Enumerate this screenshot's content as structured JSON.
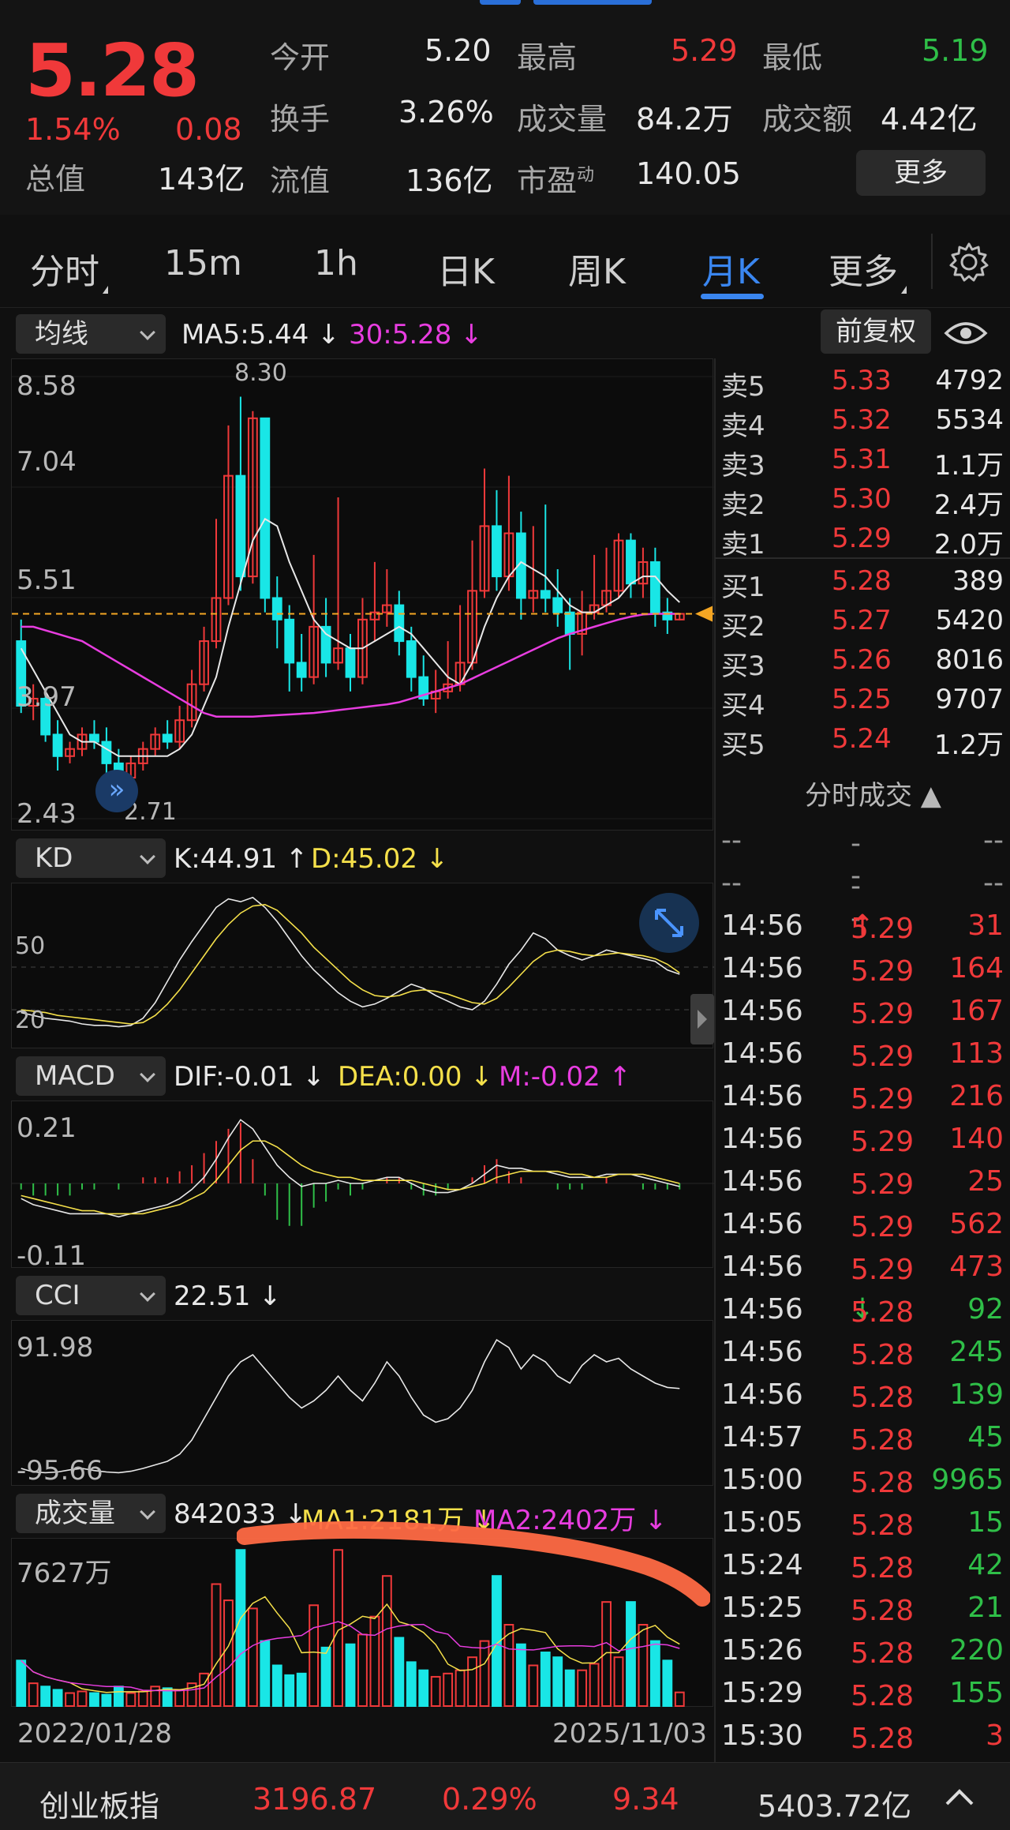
{
  "quote": {
    "price": "5.28",
    "change_pct": "1.54%",
    "change": "0.08",
    "open_label": "今开",
    "open": "5.20",
    "high_label": "最高",
    "high": "5.29",
    "low_label": "最低",
    "low": "5.19",
    "turnover_label": "换手",
    "turnover": "3.26%",
    "volume_label": "成交量",
    "volume": "84.2万",
    "amount_label": "成交额",
    "amount": "4.42亿",
    "mcap_label": "总值",
    "mcap": "143亿",
    "float_label": "流值",
    "float": "136亿",
    "pe_label": "市盈",
    "pe_sup": "动",
    "pe": "140.05",
    "more_label": "更多"
  },
  "tabs": [
    {
      "label": "分时"
    },
    {
      "label": "15m"
    },
    {
      "label": "1h"
    },
    {
      "label": "日K"
    },
    {
      "label": "周K"
    },
    {
      "label": "月K"
    },
    {
      "label": "更多"
    }
  ],
  "main_chart": {
    "indicator": "均线",
    "ma5": "MA5:5.44",
    "ma30": "30:5.28",
    "adjust_label": "前复权",
    "y_labels": [
      "8.58",
      "7.04",
      "5.51",
      "3.97",
      "2.43"
    ],
    "high_mark": "8.30",
    "low_mark": "2.71"
  },
  "kd": {
    "indicator": "KD",
    "k": "K:44.91",
    "d": "D:45.02",
    "levels": [
      "50",
      "20"
    ]
  },
  "macd": {
    "indicator": "MACD",
    "dif": "DIF:-0.01",
    "dea": "DEA:0.00",
    "m": "M:-0.02",
    "top": "0.21",
    "bottom": "-0.11"
  },
  "cci": {
    "indicator": "CCI",
    "value": "22.51",
    "top": "91.98",
    "bottom": "-95.66"
  },
  "vol": {
    "indicator": "成交量",
    "value": "842033",
    "ma1": "MA1:2181万",
    "ma2": "MA2:2402万",
    "top": "7627万"
  },
  "dates": {
    "start": "2022/01/28",
    "end": "2025/11/03"
  },
  "order_book": {
    "asks": [
      {
        "label": "卖5",
        "price": "5.33",
        "qty": "4792"
      },
      {
        "label": "卖4",
        "price": "5.32",
        "qty": "5534"
      },
      {
        "label": "卖3",
        "price": "5.31",
        "qty": "1.1万"
      },
      {
        "label": "卖2",
        "price": "5.30",
        "qty": "2.4万"
      },
      {
        "label": "卖1",
        "price": "5.29",
        "qty": "2.0万"
      }
    ],
    "bids": [
      {
        "label": "买1",
        "price": "5.28",
        "qty": "389"
      },
      {
        "label": "买2",
        "price": "5.27",
        "qty": "5420"
      },
      {
        "label": "买3",
        "price": "5.26",
        "qty": "8016"
      },
      {
        "label": "买4",
        "price": "5.25",
        "qty": "9707"
      },
      {
        "label": "买5",
        "price": "5.24",
        "qty": "1.2万"
      }
    ]
  },
  "trades_title": "分时成交",
  "trades": [
    {
      "time": "--",
      "price": "--",
      "vol": "--",
      "dir": "none"
    },
    {
      "time": "--",
      "price": "--",
      "vol": "--",
      "dir": "none"
    },
    {
      "time": "14:56",
      "price": "5.29",
      "vol": "31",
      "dir": "up"
    },
    {
      "time": "14:56",
      "price": "5.29",
      "vol": "164",
      "dir": "buy"
    },
    {
      "time": "14:56",
      "price": "5.29",
      "vol": "167",
      "dir": "buy"
    },
    {
      "time": "14:56",
      "price": "5.29",
      "vol": "113",
      "dir": "buy"
    },
    {
      "time": "14:56",
      "price": "5.29",
      "vol": "216",
      "dir": "buy"
    },
    {
      "time": "14:56",
      "price": "5.29",
      "vol": "140",
      "dir": "buy"
    },
    {
      "time": "14:56",
      "price": "5.29",
      "vol": "25",
      "dir": "buy"
    },
    {
      "time": "14:56",
      "price": "5.29",
      "vol": "562",
      "dir": "buy"
    },
    {
      "time": "14:56",
      "price": "5.29",
      "vol": "473",
      "dir": "buy"
    },
    {
      "time": "14:56",
      "price": "5.28",
      "vol": "92",
      "dir": "down"
    },
    {
      "time": "14:56",
      "price": "5.28",
      "vol": "245",
      "dir": "sell"
    },
    {
      "time": "14:56",
      "price": "5.28",
      "vol": "139",
      "dir": "sell"
    },
    {
      "time": "14:57",
      "price": "5.28",
      "vol": "45",
      "dir": "sell"
    },
    {
      "time": "15:00",
      "price": "5.28",
      "vol": "9965",
      "dir": "sell"
    },
    {
      "time": "15:05",
      "price": "5.28",
      "vol": "15",
      "dir": "sell"
    },
    {
      "time": "15:24",
      "price": "5.28",
      "vol": "42",
      "dir": "sell"
    },
    {
      "time": "15:25",
      "price": "5.28",
      "vol": "21",
      "dir": "sell"
    },
    {
      "time": "15:26",
      "price": "5.28",
      "vol": "220",
      "dir": "sell"
    },
    {
      "time": "15:29",
      "price": "5.28",
      "vol": "155",
      "dir": "sell"
    },
    {
      "time": "15:30",
      "price": "5.28",
      "vol": "3",
      "dir": "buy"
    }
  ],
  "bottom": {
    "index_name": "创业板指",
    "index_value": "3196.87",
    "index_pct": "0.29%",
    "index_change": "9.34",
    "index_amount": "5403.72亿"
  },
  "colors": {
    "up": "#f0393a",
    "down": "#2fbf48",
    "candle_down": "#19e6e6",
    "accent": "#3a86f0"
  },
  "chart_data": {
    "type": "candlestick",
    "title": "",
    "xlabel": "",
    "ylabel": "",
    "x_range": [
      "2022/01/28",
      "2025/11/03"
    ],
    "ylim": [
      2.43,
      8.58
    ],
    "candles": [
      [
        4.9,
        4.0,
        5.2,
        3.9
      ],
      [
        4.0,
        4.1,
        4.3,
        3.8
      ],
      [
        4.1,
        3.6,
        4.2,
        3.5
      ],
      [
        3.6,
        3.3,
        3.8,
        3.1
      ],
      [
        3.3,
        3.4,
        3.5,
        3.2
      ],
      [
        3.4,
        3.6,
        3.7,
        3.3
      ],
      [
        3.6,
        3.5,
        3.8,
        3.4
      ],
      [
        3.5,
        3.2,
        3.7,
        2.9
      ],
      [
        3.2,
        3.0,
        3.4,
        2.71
      ],
      [
        3.0,
        3.2,
        3.3,
        2.9
      ],
      [
        3.2,
        3.4,
        3.5,
        3.1
      ],
      [
        3.4,
        3.6,
        3.7,
        3.3
      ],
      [
        3.6,
        3.5,
        3.8,
        3.4
      ],
      [
        3.5,
        3.8,
        4.0,
        3.4
      ],
      [
        3.8,
        4.3,
        4.5,
        3.7
      ],
      [
        4.3,
        4.9,
        5.1,
        4.2
      ],
      [
        4.9,
        5.5,
        6.6,
        4.8
      ],
      [
        5.5,
        7.2,
        7.9,
        5.4
      ],
      [
        7.2,
        5.8,
        8.3,
        5.6
      ],
      [
        5.8,
        8.0,
        8.1,
        5.7
      ],
      [
        8.0,
        5.5,
        8.0,
        5.3
      ],
      [
        5.5,
        5.2,
        5.8,
        4.8
      ],
      [
        5.2,
        4.6,
        5.4,
        4.2
      ],
      [
        4.6,
        4.4,
        5.0,
        4.2
      ],
      [
        4.4,
        5.1,
        6.1,
        4.3
      ],
      [
        5.1,
        4.6,
        5.5,
        4.4
      ],
      [
        4.6,
        4.8,
        6.9,
        4.5
      ],
      [
        4.8,
        4.4,
        5.0,
        4.2
      ],
      [
        4.4,
        5.2,
        5.5,
        4.3
      ],
      [
        5.2,
        5.3,
        6.0,
        4.9
      ],
      [
        5.3,
        5.4,
        5.9,
        5.1
      ],
      [
        5.4,
        4.9,
        5.6,
        4.7
      ],
      [
        4.9,
        4.4,
        5.1,
        4.2
      ],
      [
        4.4,
        4.1,
        4.7,
        4.0
      ],
      [
        4.1,
        4.2,
        4.5,
        3.9
      ],
      [
        4.2,
        4.3,
        4.9,
        4.1
      ],
      [
        4.3,
        4.6,
        5.4,
        4.2
      ],
      [
        4.6,
        5.6,
        6.3,
        4.5
      ],
      [
        5.6,
        6.5,
        7.3,
        5.5
      ],
      [
        6.5,
        5.8,
        7.0,
        5.6
      ],
      [
        5.8,
        6.4,
        7.2,
        5.6
      ],
      [
        6.4,
        5.5,
        6.7,
        5.2
      ],
      [
        5.5,
        5.6,
        6.5,
        5.3
      ],
      [
        5.6,
        5.5,
        6.8,
        5.3
      ],
      [
        5.5,
        5.3,
        5.9,
        5.1
      ],
      [
        5.3,
        5.0,
        5.5,
        4.5
      ],
      [
        5.0,
        5.3,
        5.6,
        4.7
      ],
      [
        5.3,
        5.4,
        6.1,
        5.2
      ],
      [
        5.4,
        5.6,
        6.2,
        5.3
      ],
      [
        5.6,
        6.3,
        6.4,
        5.5
      ],
      [
        6.3,
        5.7,
        6.4,
        5.5
      ],
      [
        5.7,
        6.0,
        6.2,
        5.5
      ],
      [
        6.0,
        5.3,
        6.2,
        5.1
      ],
      [
        5.3,
        5.2,
        5.5,
        5.0
      ],
      [
        5.2,
        5.28,
        5.29,
        5.19
      ]
    ],
    "ma5": [
      4.8,
      4.5,
      4.2,
      3.9,
      3.6,
      3.5,
      3.5,
      3.4,
      3.3,
      3.3,
      3.3,
      3.3,
      3.3,
      3.4,
      3.6,
      4.0,
      4.4,
      5.1,
      5.7,
      6.3,
      6.6,
      6.5,
      6.0,
      5.6,
      5.2,
      5.0,
      4.9,
      4.8,
      4.8,
      4.9,
      5.0,
      5.1,
      5.0,
      4.8,
      4.6,
      4.4,
      4.3,
      4.6,
      5.1,
      5.5,
      5.8,
      6.0,
      5.9,
      5.8,
      5.6,
      5.4,
      5.3,
      5.3,
      5.4,
      5.5,
      5.7,
      5.8,
      5.8,
      5.6,
      5.44
    ],
    "ma30": [
      5.1,
      5.1,
      5.05,
      5.0,
      4.95,
      4.9,
      4.8,
      4.7,
      4.6,
      4.5,
      4.4,
      4.3,
      4.2,
      4.1,
      4.0,
      3.9,
      3.85,
      3.85,
      3.85,
      3.85,
      3.86,
      3.87,
      3.88,
      3.89,
      3.9,
      3.92,
      3.94,
      3.96,
      3.98,
      4.0,
      4.02,
      4.05,
      4.1,
      4.15,
      4.2,
      4.25,
      4.3,
      4.38,
      4.46,
      4.54,
      4.62,
      4.7,
      4.78,
      4.86,
      4.94,
      5.0,
      5.05,
      5.1,
      5.15,
      5.2,
      5.24,
      5.27,
      5.28,
      5.28,
      5.28
    ],
    "volume": [
      28,
      14,
      12,
      10,
      8,
      9,
      8,
      7,
      12,
      8,
      9,
      12,
      11,
      10,
      14,
      20,
      75,
      65,
      96,
      60,
      40,
      25,
      19,
      20,
      62,
      36,
      96,
      38,
      44,
      55,
      80,
      42,
      27,
      22,
      18,
      20,
      22,
      30,
      40,
      80,
      50,
      38,
      25,
      33,
      30,
      22,
      22,
      26,
      64,
      30,
      64,
      50,
      40,
      28,
      8.42
    ]
  }
}
